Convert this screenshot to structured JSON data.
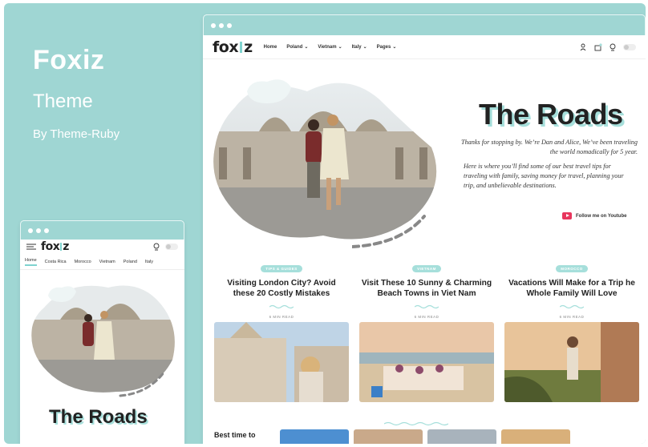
{
  "brand": {
    "title": "Foxiz",
    "subtitle": "Theme",
    "byline": "By Theme-Ruby"
  },
  "colors": {
    "background": "#9fd6d3",
    "accent": "#a6dfdb",
    "youtube": "#e8365d",
    "text": "#222222"
  },
  "desktop": {
    "logo_left": "fox",
    "logo_right": "z",
    "nav": [
      "Home",
      "Poland",
      "Vietnam",
      "Italy",
      "Pages"
    ],
    "nav_icons": [
      "bookmark-person-icon",
      "notification-icon",
      "user-icon",
      "dark-mode-toggle"
    ],
    "hero": {
      "title": "The Roads",
      "intro": "Thanks for stopping by. We’re Dan and Alice, We’ve been traveling the world nomadically for 5 year.",
      "body": "Here is where you’ll find some of our best travel tips for traveling with family, saving money for travel, planning your trip, and unbelievable destinations.",
      "youtube_label": "Follow me on Youtube"
    },
    "cards": [
      {
        "tag": "TIPS & GUIDES",
        "title_1": "Visiting London City? Avoid",
        "title_2": "these 20 Costly Mistakes",
        "read": "6 MIN READ"
      },
      {
        "tag": "VIETNAM",
        "title_1": "Visit These 10 Sunny & Charming",
        "title_2": "Beach Towns in Viet Nam",
        "read": "6 MIN READ"
      },
      {
        "tag": "MOROCCO",
        "title_1": "Vacations Will Make for a Trip he",
        "title_2": "Whole Family Will Love",
        "read": "6 MIN READ"
      }
    ],
    "section_title": "Best time to"
  },
  "mobile": {
    "logo_left": "fox",
    "logo_right": "z",
    "tabs": [
      "Home",
      "Costa Rica",
      "Morocco",
      "Vietnam",
      "Poland",
      "Italy"
    ],
    "title": "The Roads"
  }
}
